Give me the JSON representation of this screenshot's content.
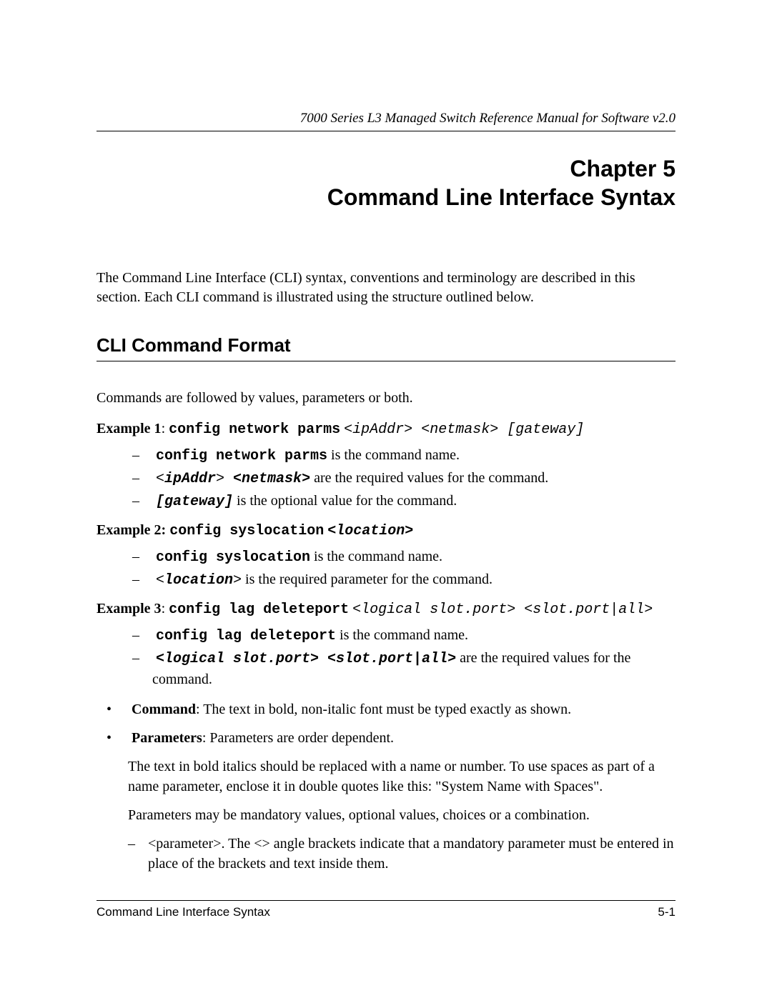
{
  "header": {
    "manual_title": "7000 Series L3 Managed Switch Reference Manual for Software v2.0"
  },
  "chapter": {
    "line1": "Chapter 5",
    "line2": "Command Line Interface Syntax"
  },
  "intro": "The Command Line Interface (CLI) syntax, conventions and terminology are described in this section. Each CLI command is illustrated using the structure outlined below.",
  "section_heading": "CLI Command Format",
  "lead": "Commands are followed by values, parameters or both.",
  "example1": {
    "label": "Example 1",
    "cmd": "config network parms",
    "args": "<ipAddr> <netmask> [gateway]",
    "d1_cmd": "config network parms",
    "d1_rest": " is the command name.",
    "d2_pre": "<",
    "d2_a": "ipAddr",
    "d2_mid": ">  ",
    "d2_b": "<netmask>",
    "d2_rest": "  are the required values for the command.",
    "d3_a": "[gateway]",
    "d3_rest": "  is the optional value for the command."
  },
  "example2": {
    "label": "Example 2:",
    "cmd": "config syslocation",
    "args_a": "<",
    "args_b": "location",
    "args_c": ">",
    "d1_cmd": "config syslocation",
    "d1_rest": "  is the command name.",
    "d2_pre": "<",
    "d2_a": "location",
    "d2_post": ">",
    "d2_rest": "  is the required parameter for the command."
  },
  "example3": {
    "label": "Example 3",
    "cmd": "config lag deleteport",
    "args": "<logical slot.port> <slot.port|all>",
    "d1_cmd": "config lag deleteport",
    "d1_rest": " is the command name.",
    "d2_a": "<logical slot.port> <slot.port|all>",
    "d2_rest": "  are the required values for the command."
  },
  "bullets": {
    "b1_label": "Command",
    "b1_rest": ": The text in bold, non-italic font must be typed exactly as shown.",
    "b2_label": "Parameters",
    "b2_rest": ": Parameters are order dependent.",
    "b2_p1": "The text in bold italics should be replaced with a name or number. To use spaces as part of a name parameter, enclose it in double quotes like this: \"System Name with Spaces\".",
    "b2_p2": "Parameters may be mandatory values, optional values, choices or a combination.",
    "b2_d1": "<parameter>. The <> angle brackets indicate that a mandatory parameter must be entered in place of the brackets and text inside them."
  },
  "footer": {
    "left": "Command Line Interface Syntax",
    "right": "5-1"
  }
}
